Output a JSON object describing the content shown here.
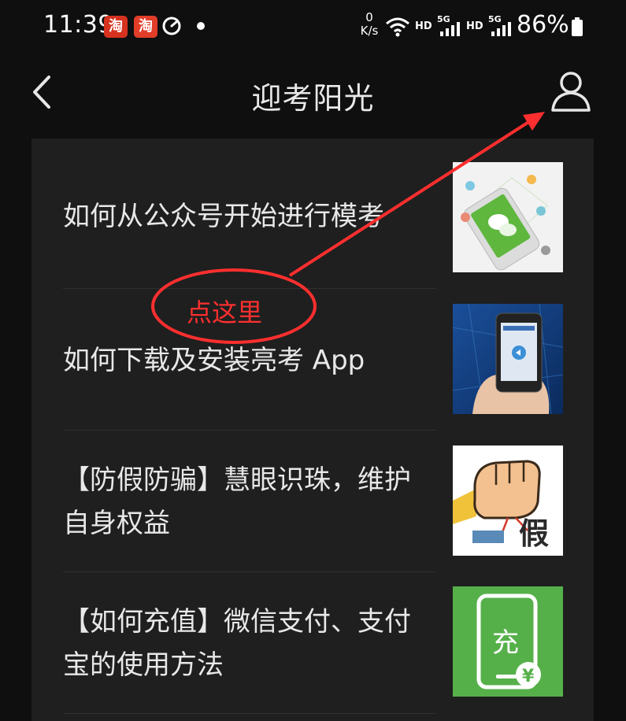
{
  "status_bar": {
    "time": "11:39",
    "app_icon_1": "淘",
    "app_icon_2": "淘",
    "net_speed_value": "0",
    "net_speed_unit": "K/s",
    "hd_1": "HD",
    "hd_2": "HD",
    "sig_1_label": "5G",
    "sig_2_label": "5G",
    "battery": "86%"
  },
  "header": {
    "title": "迎考阳光"
  },
  "articles": [
    {
      "title": "如何从公众号开始进行模考",
      "thumb_icon": "wechat-phone-icon"
    },
    {
      "title": "如何下载及安装亮考 App",
      "thumb_icon": "phone-in-hand-icon"
    },
    {
      "title": "【防假防骗】慧眼识珠，维护自身权益",
      "thumb_icon": "fist-fake-icon",
      "thumb_text": "假"
    },
    {
      "title": "【如何充值】微信支付、支付宝的使用方法",
      "thumb_icon": "phone-recharge-icon",
      "thumb_text": "充",
      "thumb_yen": "¥"
    }
  ],
  "annotation": {
    "label": "点这里",
    "color": "#ff2f2f"
  }
}
